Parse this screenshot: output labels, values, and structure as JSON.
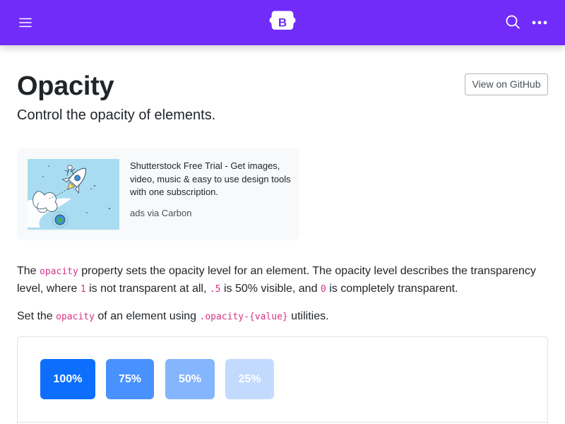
{
  "colors": {
    "navbar_bg": "#712cf9",
    "primary": "#0d6efd",
    "code": "#d63384",
    "ad_bg": "#f8f9fa"
  },
  "navbar": {
    "menu_icon": "hamburger-menu-icon",
    "brand_letter": "B",
    "search_icon": "search-icon",
    "more_icon": "more-horizontal-icon"
  },
  "page": {
    "title": "Opacity",
    "lead": "Control the opacity of elements.",
    "github_label": "View on GitHub"
  },
  "ad": {
    "text": "Shutterstock Free Trial - Get images, video, music & easy to use design tools with one subscription.",
    "via": "ads via Carbon"
  },
  "content": {
    "p1": {
      "t1": "The ",
      "c1": "opacity",
      "t2": " property sets the opacity level for an element. The opacity level describes the transparency level, where ",
      "c2": "1",
      "t3": " is not transparent at all, ",
      "c3": ".5",
      "t4": " is 50% visible, and ",
      "c4": "0",
      "t5": " is completely transparent."
    },
    "p2": {
      "t1": "Set the ",
      "c1": "opacity",
      "t2": " of an element using ",
      "c2": ".opacity-{value}",
      "t3": " utilities."
    }
  },
  "example": {
    "boxes": [
      {
        "label": "100%",
        "opacity": 1
      },
      {
        "label": "75%",
        "opacity": 0.75
      },
      {
        "label": "50%",
        "opacity": 0.5
      },
      {
        "label": "25%",
        "opacity": 0.25
      }
    ]
  }
}
